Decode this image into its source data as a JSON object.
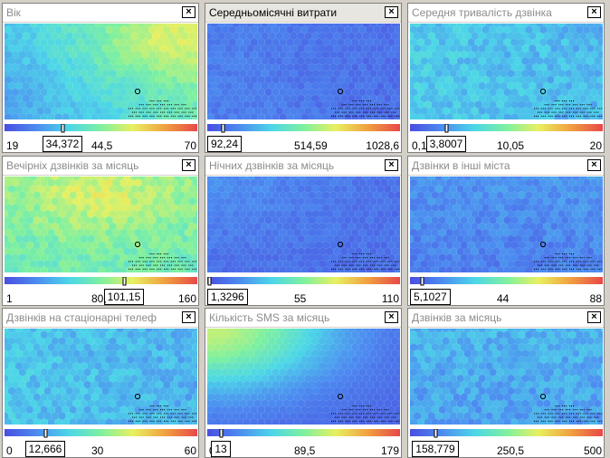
{
  "panels": [
    {
      "title": "Вік",
      "min": "19",
      "mid": "44,5",
      "max": "70",
      "value": "34,372",
      "marker": 0.3,
      "active": false,
      "palette": "age"
    },
    {
      "title": "Середньомісячні витрати",
      "min": "",
      "mid": "514,59",
      "max": "1028,6",
      "value": "92,24",
      "marker": 0.08,
      "active": true,
      "palette": "spend"
    },
    {
      "title": "Середня тривалість дзвінка",
      "min": "0,1",
      "mid": "10,05",
      "max": "20",
      "value": "3,8007",
      "marker": 0.19,
      "active": false,
      "palette": "dur"
    },
    {
      "title": "Вечірніх дзвінків за місяць",
      "min": "1",
      "mid": "80,",
      "max": "160",
      "value": "101,15",
      "marker": 0.62,
      "active": false,
      "palette": "evening"
    },
    {
      "title": "Нічних дзвінків за місяць",
      "min": "",
      "mid": "55",
      "max": "110",
      "value": "1,3296",
      "marker": 0.01,
      "active": false,
      "palette": "night"
    },
    {
      "title": "Дзвінки в інші міста",
      "min": "",
      "mid": "44",
      "max": "88",
      "value": "5,1027",
      "marker": 0.06,
      "active": false,
      "palette": "intercity"
    },
    {
      "title": "Дзвінків на стаціонарні телеф",
      "min": "0",
      "mid": "30",
      "max": "60",
      "value": "12,666",
      "marker": 0.21,
      "active": false,
      "palette": "landline"
    },
    {
      "title": "Кількість SMS за місяць",
      "min": "0",
      "mid": "89,5",
      "max": "179",
      "value": "13",
      "marker": 0.07,
      "active": false,
      "palette": "sms"
    },
    {
      "title": "Дзвінків за місяць",
      "min": "",
      "mid": "250,5",
      "max": "500",
      "value": "158,779",
      "marker": 0.13,
      "active": false,
      "palette": "calls"
    }
  ],
  "close_glyph": "×",
  "colors": {
    "scale": [
      "#4a4ee0",
      "#4c8cf0",
      "#4cd6e8",
      "#7ef0a0",
      "#e8f060",
      "#f0a040",
      "#e84848"
    ]
  }
}
